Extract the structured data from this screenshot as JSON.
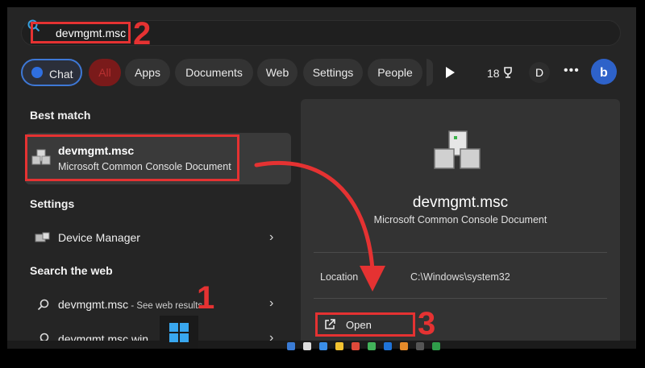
{
  "search": {
    "query": "devmgmt.msc"
  },
  "tabs": [
    "Chat",
    "All",
    "Apps",
    "Documents",
    "Web",
    "Settings",
    "People"
  ],
  "toolbar": {
    "points": "18",
    "avatar_initial": "D",
    "more": "•••"
  },
  "left_panel": {
    "best_match_heading": "Best match",
    "best_match": {
      "title": "devmgmt.msc",
      "subtitle": "Microsoft Common Console Document"
    },
    "settings_heading": "Settings",
    "settings_item": "Device Manager",
    "web_heading": "Search the web",
    "web_results": [
      {
        "text": "devmgmt.msc",
        "suffix": " - See web results"
      },
      {
        "text": "devmgmt.msc win"
      }
    ]
  },
  "detail": {
    "title": "devmgmt.msc",
    "subtitle": "Microsoft Common Console Document",
    "location_label": "Location",
    "location_value": "C:\\Windows\\system32",
    "open_label": "Open"
  },
  "annotations": {
    "step1": "1",
    "step2": "2",
    "step3": "3"
  },
  "colors": {
    "annotation": "#e53232",
    "accent": "#3e78d6"
  }
}
